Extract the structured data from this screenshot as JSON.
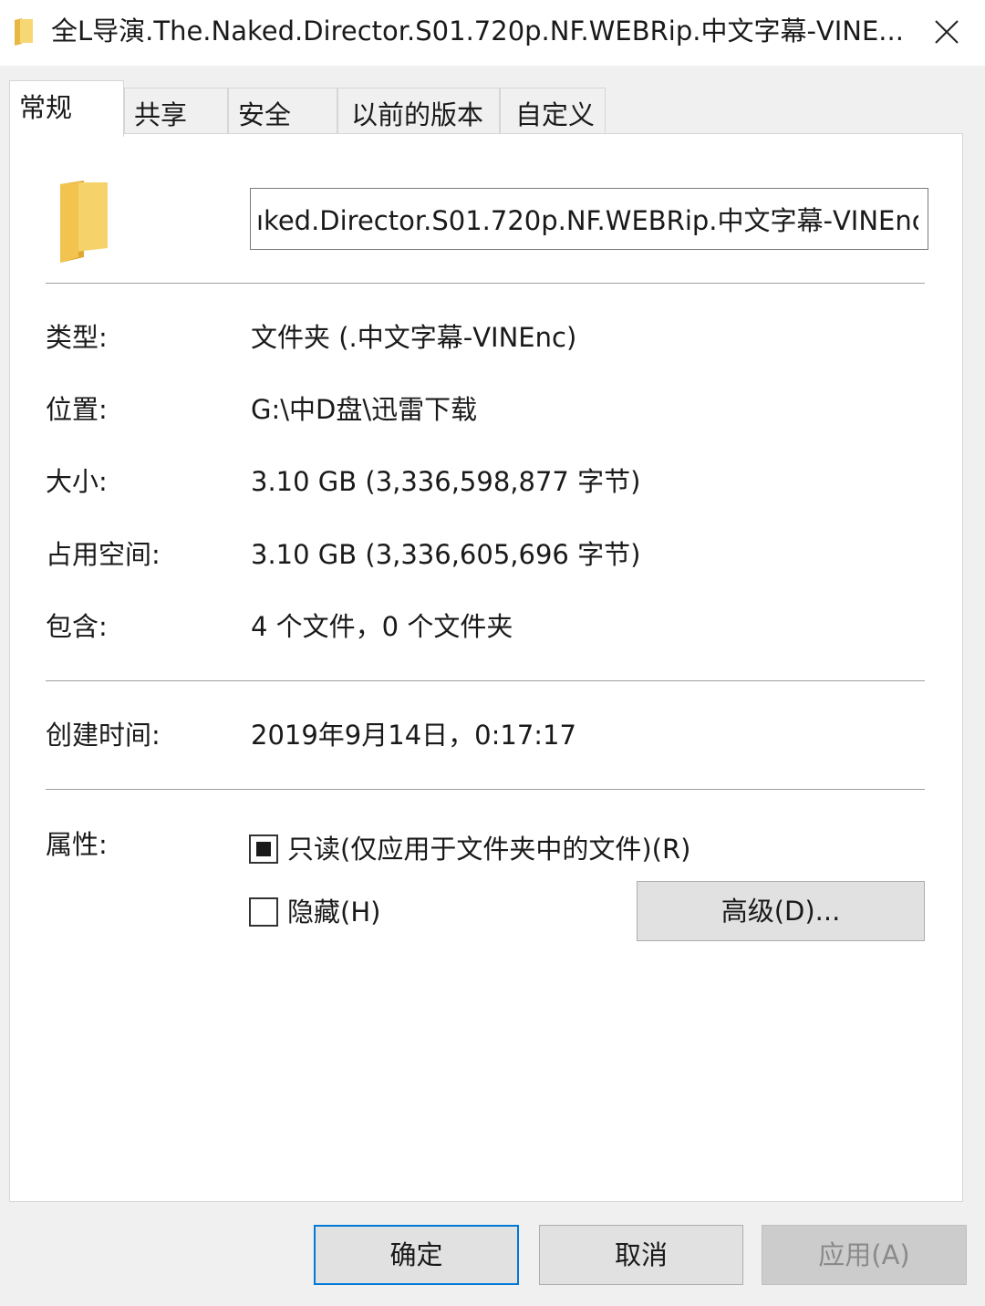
{
  "window": {
    "title": "全L导演.The.Naked.Director.S01.720p.NF.WEBRip.中文字幕-VINE...",
    "close_icon": "close-icon",
    "title_icon": "folder-icon"
  },
  "tabs": [
    {
      "label": "常规",
      "active": true
    },
    {
      "label": "共享",
      "active": false
    },
    {
      "label": "安全",
      "active": false
    },
    {
      "label": "以前的版本",
      "active": false
    },
    {
      "label": "自定义",
      "active": false
    }
  ],
  "general": {
    "folder_icon": "folder-icon",
    "name_value": "ıked.Director.S01.720p.NF.WEBRip.中文字幕-VINEnc",
    "type_label": "类型:",
    "type_value": "文件夹 (.中文字幕-VINEnc)",
    "location_label": "位置:",
    "location_value": "G:\\中D盘\\迅雷下载",
    "size_label": "大小:",
    "size_value": "3.10 GB (3,336,598,877 字节)",
    "size_on_disk_label": "占用空间:",
    "size_on_disk_value": "3.10 GB (3,336,605,696 字节)",
    "contains_label": "包含:",
    "contains_value": "4 个文件，0 个文件夹",
    "created_label": "创建时间:",
    "created_value": "2019年9月14日，0:17:17",
    "attributes_label": "属性:",
    "readonly_label": "只读(仅应用于文件夹中的文件)(R)",
    "readonly_state": "indeterminate",
    "hidden_label": "隐藏(H)",
    "hidden_checked": false,
    "advanced_button": "高级(D)..."
  },
  "footer": {
    "ok": "确定",
    "cancel": "取消",
    "apply": "应用(A)",
    "apply_enabled": false
  }
}
